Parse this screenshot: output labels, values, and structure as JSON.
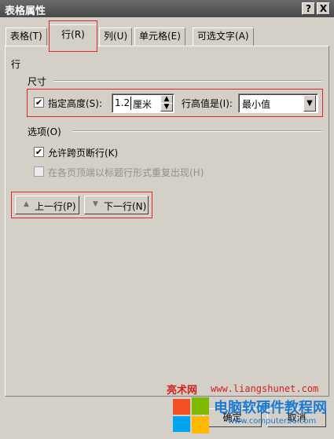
{
  "window": {
    "title": "表格属性",
    "help_label": "?",
    "close_label": "X"
  },
  "tabs": [
    {
      "label": "表格(T)"
    },
    {
      "label": "行(R)"
    },
    {
      "label": "列(U)"
    },
    {
      "label": "单元格(E)"
    },
    {
      "label": "可选文字(A)"
    }
  ],
  "row": {
    "group_label": "行",
    "size_label": "尺寸",
    "specify_height_label": "指定高度(S):",
    "height_value": "1.2",
    "height_unit": "厘米",
    "height_is_label": "行高值是(I):",
    "height_mode": "最小值",
    "options_label": "选项(O)",
    "allow_break_label": "允许跨页断行(K)",
    "repeat_header_label": "在各页顶端以标题行形式重复出现(H)",
    "prev_row_label": "上一行(P)",
    "next_row_label": "下一行(N)"
  },
  "footer": {
    "ok_label": "确定",
    "cancel_label": "取消"
  },
  "watermark": {
    "brand": "亮术网",
    "url": "www.liangshunet.com",
    "site_name": "电脑软硬件教程网",
    "site_url": "www.computer26.com"
  },
  "colors": {
    "highlight": "#e02424",
    "watermark_red": "#d02020",
    "watermark_blue": "#1a7ad4"
  }
}
